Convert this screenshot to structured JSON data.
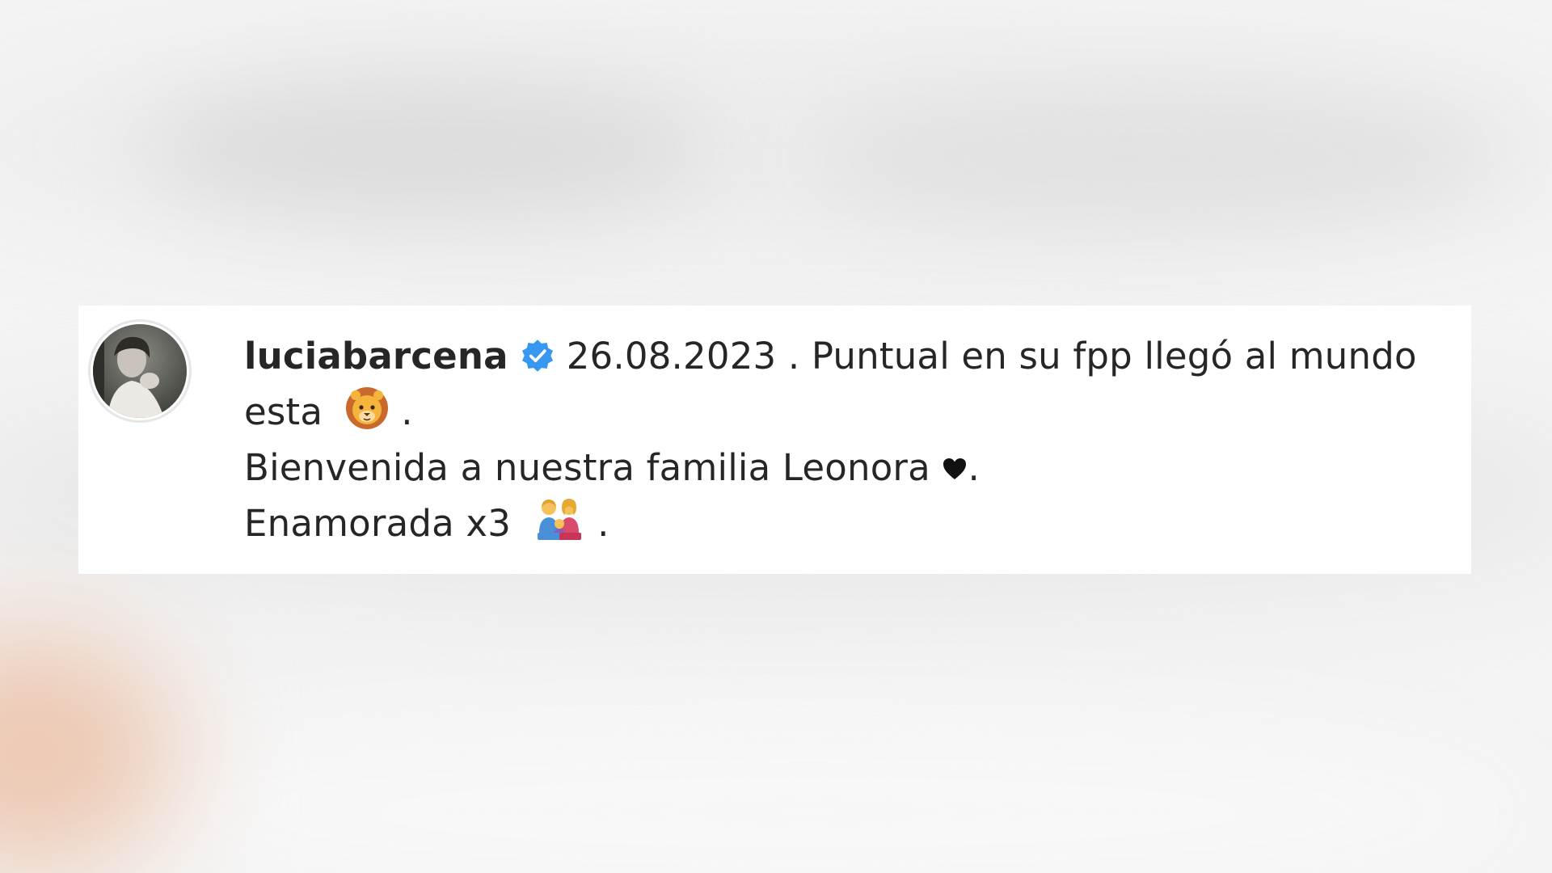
{
  "comment": {
    "username": "luciabarcena",
    "line1_text": "26.08.2023 . Puntual en su fpp llegó al mundo",
    "line2_text": "esta",
    "line2_end": ".",
    "line3_text": "Bienvenida a nuestra familia Leonora",
    "line3_end": ".",
    "line4_text": "Enamorada x3",
    "line4_end": "."
  },
  "icons": {
    "verified": "verified-badge-icon",
    "lion": "lion-face-emoji",
    "heart": "black-heart-icon",
    "family": "family-emoji"
  },
  "colors": {
    "verified_blue": "#3897f0",
    "text": "#262626",
    "card_bg": "#ffffff"
  }
}
